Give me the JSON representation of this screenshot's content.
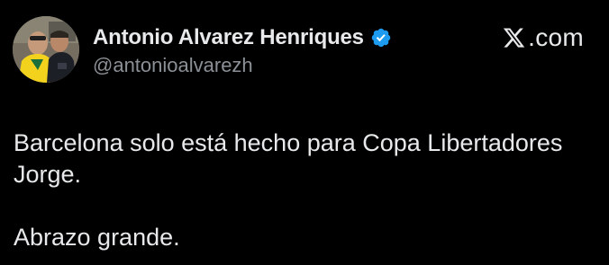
{
  "author": {
    "display_name": "Antonio Alvarez Henriques",
    "handle": "@antonioalvarezh",
    "avatar_icon": "profile-photo",
    "verified_icon": "verified-badge-icon",
    "verified_color": "#1d9bf0"
  },
  "brand": {
    "logo_icon": "x-logo-icon",
    "text": ".com"
  },
  "tweet": {
    "lines": [
      "Barcelona solo está hecho para Copa Libertadores",
      "Jorge.",
      "Abrazo grande."
    ]
  },
  "colors": {
    "background": "#000000",
    "primary_text": "#e7e9ea",
    "secondary_text": "#8b9096"
  }
}
